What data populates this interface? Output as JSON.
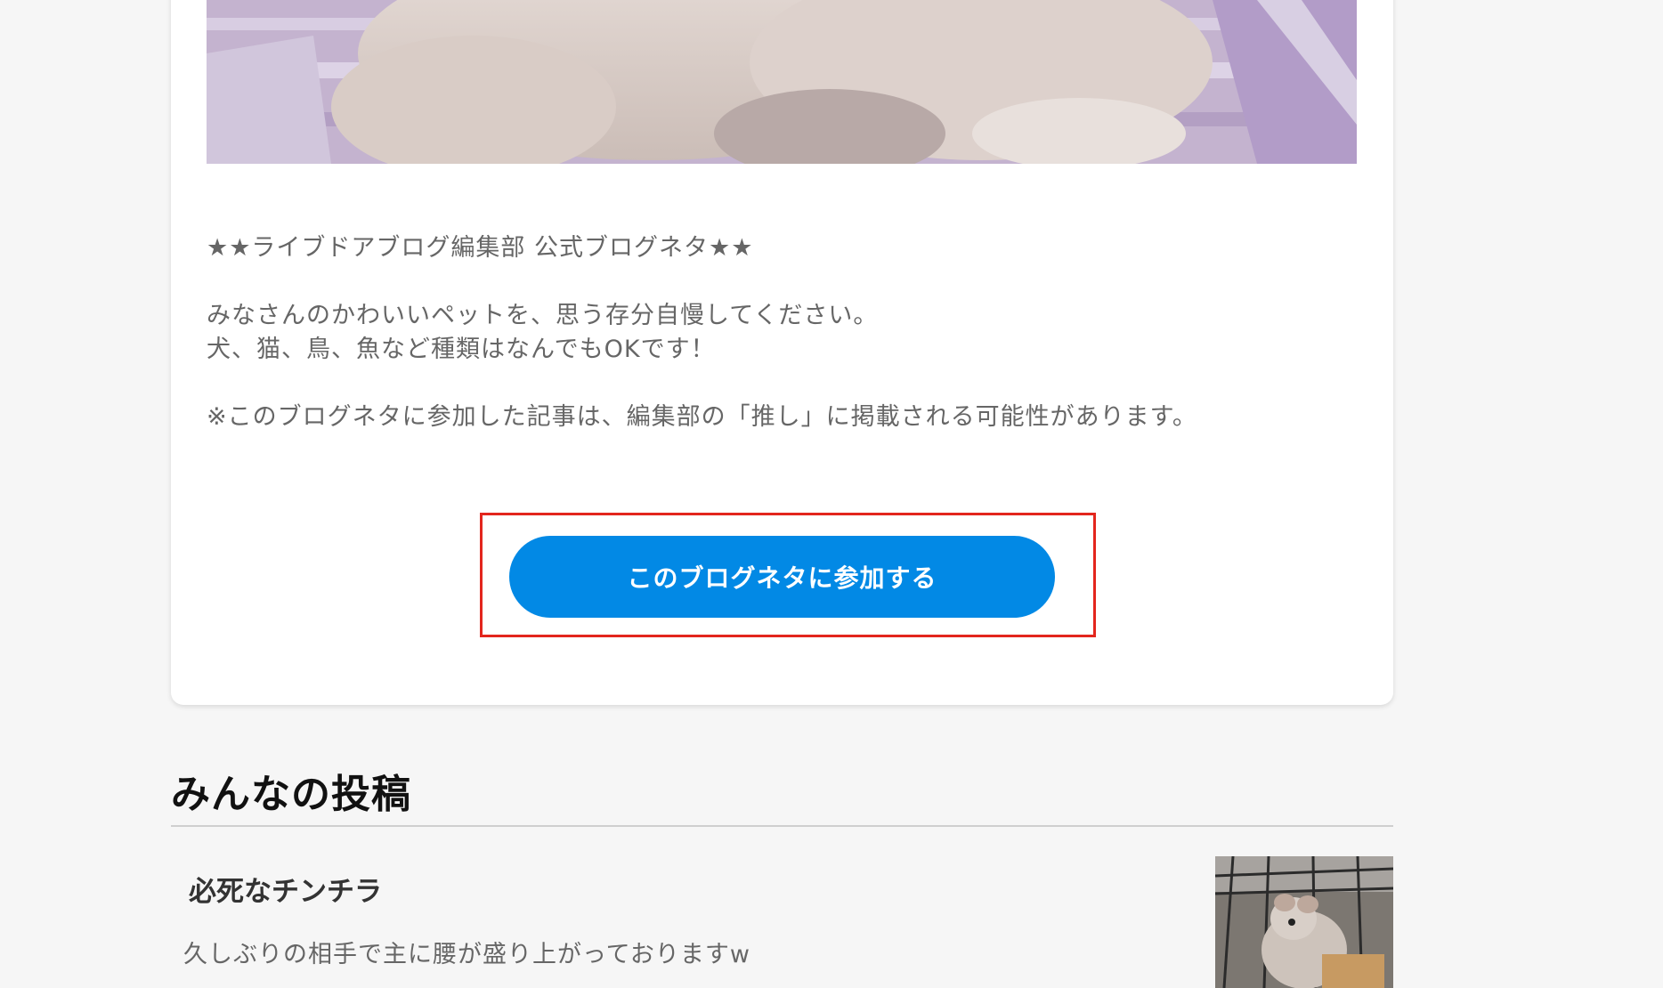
{
  "topic": {
    "header_line": "★★ライブドアブログ編集部 公式ブログネタ★★",
    "body_line_1": "みなさんのかわいいペットを、思う存分自慢してください。",
    "body_line_2": "犬、猫、鳥、魚など種類はなんでもOKです！",
    "note": "※このブログネタに参加した記事は、編集部の「推し」に掲載される可能性があります。",
    "join_button_label": "このブログネタに参加する"
  },
  "posts_section": {
    "title": "みんなの投稿",
    "items": [
      {
        "title": "必死なチンチラ",
        "excerpt": "久しぶりの相手で主に腰が盛り上がっておりますw"
      }
    ]
  },
  "colors": {
    "accent": "#0289e5",
    "highlight_border": "#e3261d"
  }
}
